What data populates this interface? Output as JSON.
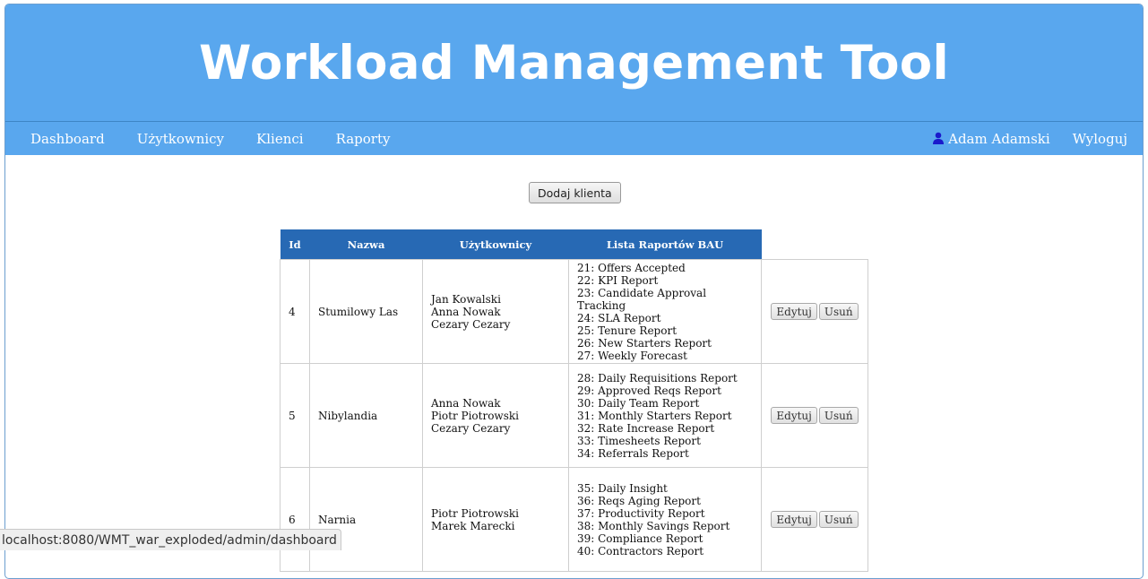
{
  "header": {
    "title": "Workload Management Tool"
  },
  "nav": {
    "items": [
      "Dashboard",
      "Użytkownicy",
      "Klienci",
      "Raporty"
    ],
    "user": "Adam Adamski",
    "logout": "Wyloguj"
  },
  "add_button": "Dodaj klienta",
  "table": {
    "headers": [
      "Id",
      "Nazwa",
      "Użytkownicy",
      "Lista Raportów BAU"
    ],
    "rows": [
      {
        "id": "4",
        "name": "Stumilowy Las",
        "users": [
          "Jan Kowalski",
          "Anna Nowak",
          "Cezary Cezary"
        ],
        "reports": [
          "21: Offers Accepted",
          "22: KPI Report",
          "23: Candidate Approval Tracking",
          "24: SLA Report",
          "25: Tenure Report",
          "26: New Starters Report",
          "27: Weekly Forecast"
        ],
        "edit": "Edytuj",
        "delete": "Usuń"
      },
      {
        "id": "5",
        "name": "Nibylandia",
        "users": [
          "Anna Nowak",
          "Piotr Piotrowski",
          "Cezary Cezary"
        ],
        "reports": [
          "28: Daily Requisitions Report",
          "29: Approved Reqs Report",
          "30: Daily Team Report",
          "31: Monthly Starters Report",
          "32: Rate Increase Report",
          "33: Timesheets Report",
          "34: Referrals Report"
        ],
        "edit": "Edytuj",
        "delete": "Usuń"
      },
      {
        "id": "6",
        "name": "Narnia",
        "users": [
          "Piotr Piotrowski",
          "Marek Marecki"
        ],
        "reports": [
          "35: Daily Insight",
          "36: Reqs Aging Report",
          "37: Productivity Report",
          "38: Monthly Savings Report",
          "39: Compliance Report",
          "40: Contractors Report"
        ],
        "edit": "Edytuj",
        "delete": "Usuń"
      }
    ]
  },
  "status_bar": "localhost:8080/WMT_war_exploded/admin/dashboard",
  "colors": {
    "header_bg": "#59a7ee",
    "table_header_bg": "#2769b4"
  }
}
